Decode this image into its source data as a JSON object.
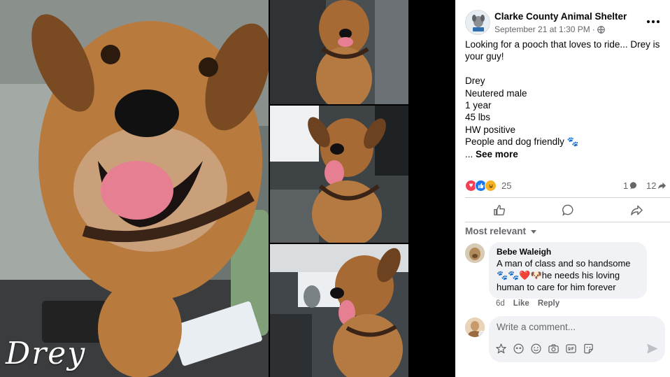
{
  "photos": {
    "signature": "Drey"
  },
  "post": {
    "page_name": "Clarke County Animal Shelter",
    "timestamp": "September 21 at 1:30 PM",
    "visibility_separator": "·",
    "lines": [
      "Looking for a pooch that loves to ride... Drey is",
      "your guy!",
      "",
      "Drey",
      "Neutered male",
      "1 year",
      "45 lbs",
      "HW positive",
      "People and dog friendly 🐾"
    ],
    "ellipsis": "...",
    "see_more": "See more"
  },
  "engagement": {
    "reaction_count": "25",
    "comment_count": "1",
    "share_count": "12",
    "reaction_types": [
      "love-icon",
      "like-icon",
      "haha-icon"
    ]
  },
  "sort": {
    "label": "Most relevant"
  },
  "comments": [
    {
      "author": "Bebe Waleigh",
      "lines": [
        "A man of class and so handsome",
        "🐾🐾❤️🐶he needs his loving",
        "human to care for him forever"
      ],
      "time": "6d",
      "like_label": "Like",
      "reply_label": "Reply"
    }
  ],
  "composer": {
    "placeholder": "Write a comment..."
  },
  "colors": {
    "text_primary": "#050505",
    "text_secondary": "#65676b",
    "bubble_bg": "#f0f2f5",
    "like_blue": "#1877f2",
    "love_red": "#f33e58"
  }
}
